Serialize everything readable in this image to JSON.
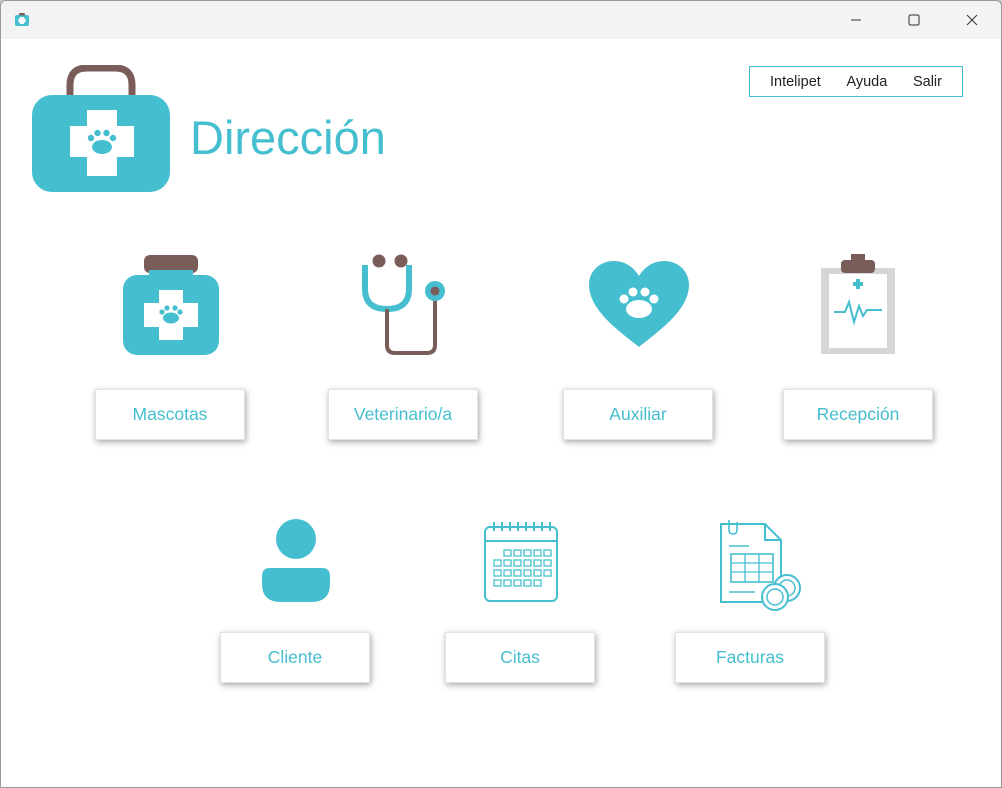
{
  "window": {
    "controls": [
      "minimize-icon",
      "maximize-icon",
      "close-icon"
    ]
  },
  "menu": {
    "items": [
      "Intelipet",
      "Ayuda",
      "Salir"
    ]
  },
  "header": {
    "title": "Dirección",
    "icon": "medical-bag-paw-icon"
  },
  "categories": [
    {
      "label": "Mascotas",
      "icon": "pet-medicine-jar-icon"
    },
    {
      "label": "Veterinario/a",
      "icon": "stethoscope-icon"
    },
    {
      "label": "Auxiliar",
      "icon": "heart-paw-icon"
    },
    {
      "label": "Recepción",
      "icon": "clipboard-heartbeat-icon"
    },
    {
      "label": "Cliente",
      "icon": "user-icon"
    },
    {
      "label": "Citas",
      "icon": "calendar-icon"
    },
    {
      "label": "Facturas",
      "icon": "invoice-icon"
    }
  ],
  "colors": {
    "accent": "#45bfcf",
    "brown": "#7a5c58",
    "gray": "#d6d6d6"
  }
}
